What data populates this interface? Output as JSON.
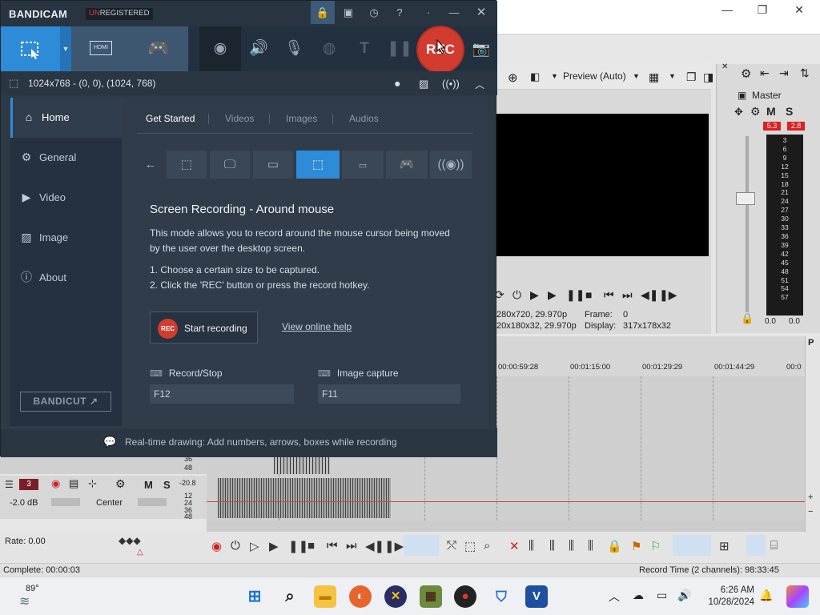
{
  "vegas": {
    "window_controls": [
      "—",
      "❐",
      "✕"
    ],
    "preview_mode": "Preview (Auto)",
    "master_label": "Master",
    "master_m": "M",
    "master_s": "S",
    "peak_left": "5.3",
    "peak_right": "2.8",
    "meter_ticks": [
      "3",
      "6",
      "9",
      "12",
      "15",
      "18",
      "21",
      "24",
      "27",
      "30",
      "33",
      "36",
      "39",
      "42",
      "45",
      "48",
      "51",
      "54",
      "57"
    ],
    "meter_floor_left": "0.0",
    "meter_floor_right": "0.0",
    "info": {
      "line1_left": "280x720, 29.970p",
      "line1_frame_label": "Frame:",
      "line1_frame_value": "0",
      "line2_left": "20x180x32, 29.970p",
      "line2_display_label": "Display:",
      "line2_display_value": "317x178x32"
    },
    "ruler": [
      "00:00:59:28",
      "00:01:15:00",
      "00:01:29:29",
      "00:01:44:29",
      "00:0"
    ],
    "track1": {
      "levels": [
        "36",
        "48"
      ]
    },
    "track2": {
      "number": "3",
      "m": "M",
      "s": "S",
      "gain": "-2.0 dB",
      "pan": "Center",
      "db_top": "-20.8",
      "levels": [
        "12",
        "24",
        "36",
        "48"
      ]
    },
    "rate": "Rate: 0.00",
    "status_left": "Complete: 00:00:03",
    "status_right": "Record Time (2 channels): 98:33:45",
    "right_bar": [
      "P",
      "+",
      "−",
      "+",
      "−"
    ]
  },
  "bandicam": {
    "logo": "BANDICAM",
    "unregistered_prefix": "UN",
    "unregistered_rest": "REGISTERED",
    "rec_label": "REC",
    "mode_hdmi_label": "HDMI",
    "resolution_info": "1024x768 - (0, 0), (1024, 768)",
    "sidebar": [
      {
        "label": "Home",
        "icon": "home-icon"
      },
      {
        "label": "General",
        "icon": "gear-icon"
      },
      {
        "label": "Video",
        "icon": "video-icon"
      },
      {
        "label": "Image",
        "icon": "image-icon"
      },
      {
        "label": "About",
        "icon": "info-icon"
      }
    ],
    "bandicut": "BANDICUT ↗",
    "tabs": [
      "Get Started",
      "Videos",
      "Images",
      "Audios"
    ],
    "heading": "Screen Recording - Around mouse",
    "description_line1": "This mode allows you to record around the mouse cursor being moved",
    "description_line2": "by the user over the desktop screen.",
    "step1": "1. Choose a certain size to be captured.",
    "step2": "2. Click the 'REC' button or press the record hotkey.",
    "start_recording_label": "Start recording",
    "start_recording_badge": "REC",
    "view_help": "View online help",
    "hotkey_record_label": "Record/Stop",
    "hotkey_record_value": "F12",
    "hotkey_image_label": "Image capture",
    "hotkey_image_value": "F11",
    "footer": "Real-time drawing: Add numbers, arrows, boxes while recording"
  },
  "taskbar": {
    "temperature": "89°",
    "time": "6:26 AM",
    "date": "10/28/2024"
  }
}
